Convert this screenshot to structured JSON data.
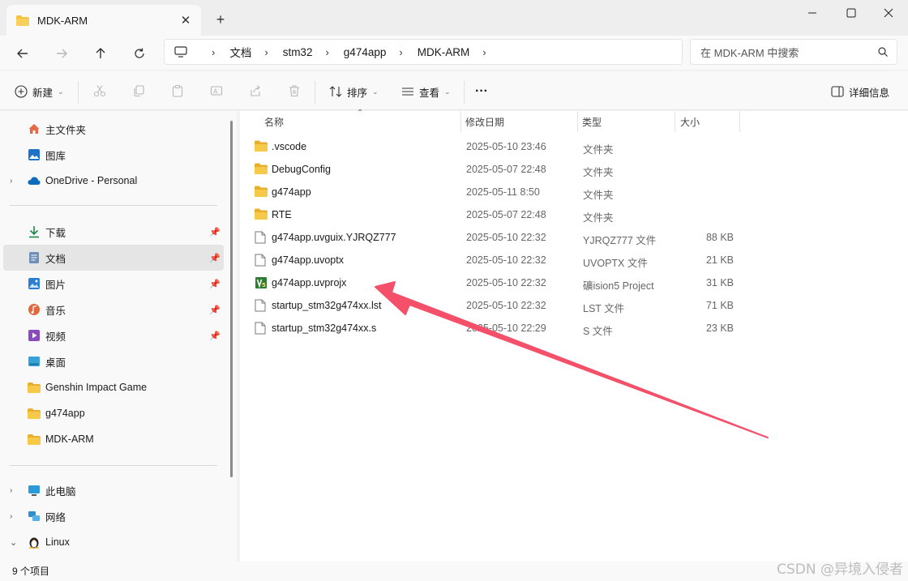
{
  "window": {
    "tab_title": "MDK-ARM",
    "tab_close": "✕",
    "new_tab": "+",
    "minimize": "—",
    "maximize": "☐",
    "close": "✕"
  },
  "nav": {
    "breadcrumb": [
      "文档",
      "stm32",
      "g474app",
      "MDK-ARM"
    ],
    "search_placeholder": "在 MDK-ARM 中搜索"
  },
  "toolbar": {
    "new_label": "新建",
    "sort_label": "排序",
    "view_label": "查看",
    "more_label": "···",
    "details_label": "详细信息"
  },
  "sidebar": {
    "home": "主文件夹",
    "gallery": "图库",
    "onedrive": "OneDrive - Personal",
    "downloads": "下载",
    "documents": "文档",
    "pictures": "图片",
    "music": "音乐",
    "videos": "视频",
    "desktop": "桌面",
    "genshin": "Genshin Impact Game",
    "g474app": "g474app",
    "mdkarm": "MDK-ARM",
    "thispc": "此电脑",
    "network": "网络",
    "linux": "Linux"
  },
  "columns": {
    "name": "名称",
    "date": "修改日期",
    "type": "类型",
    "size": "大小"
  },
  "files": [
    {
      "name": ".vscode",
      "date": "2025-05-10 23:46",
      "type": "文件夹",
      "size": "",
      "kind": "folder"
    },
    {
      "name": "DebugConfig",
      "date": "2025-05-07 22:48",
      "type": "文件夹",
      "size": "",
      "kind": "folder"
    },
    {
      "name": "g474app",
      "date": "2025-05-11 8:50",
      "type": "文件夹",
      "size": "",
      "kind": "folder"
    },
    {
      "name": "RTE",
      "date": "2025-05-07 22:48",
      "type": "文件夹",
      "size": "",
      "kind": "folder"
    },
    {
      "name": "g474app.uvguix.YJRQZ777",
      "date": "2025-05-10 22:32",
      "type": "YJRQZ777 文件",
      "size": "88 KB",
      "kind": "file"
    },
    {
      "name": "g474app.uvoptx",
      "date": "2025-05-10 22:32",
      "type": "UVOPTX 文件",
      "size": "21 KB",
      "kind": "file"
    },
    {
      "name": "g474app.uvprojx",
      "date": "2025-05-10 22:32",
      "type": "礦ision5 Project",
      "size": "31 KB",
      "kind": "keil"
    },
    {
      "name": "startup_stm32g474xx.lst",
      "date": "2025-05-10 22:32",
      "type": "LST 文件",
      "size": "71 KB",
      "kind": "file"
    },
    {
      "name": "startup_stm32g474xx.s",
      "date": "2025-05-10 22:29",
      "type": "S 文件",
      "size": "23 KB",
      "kind": "file"
    }
  ],
  "status": {
    "count": "9 个项目"
  },
  "watermark": "CSDN @异境入侵者",
  "colors": {
    "accent_arrow": "#f4506a",
    "folder": "#f5c242",
    "keil": "#2e7d32"
  }
}
